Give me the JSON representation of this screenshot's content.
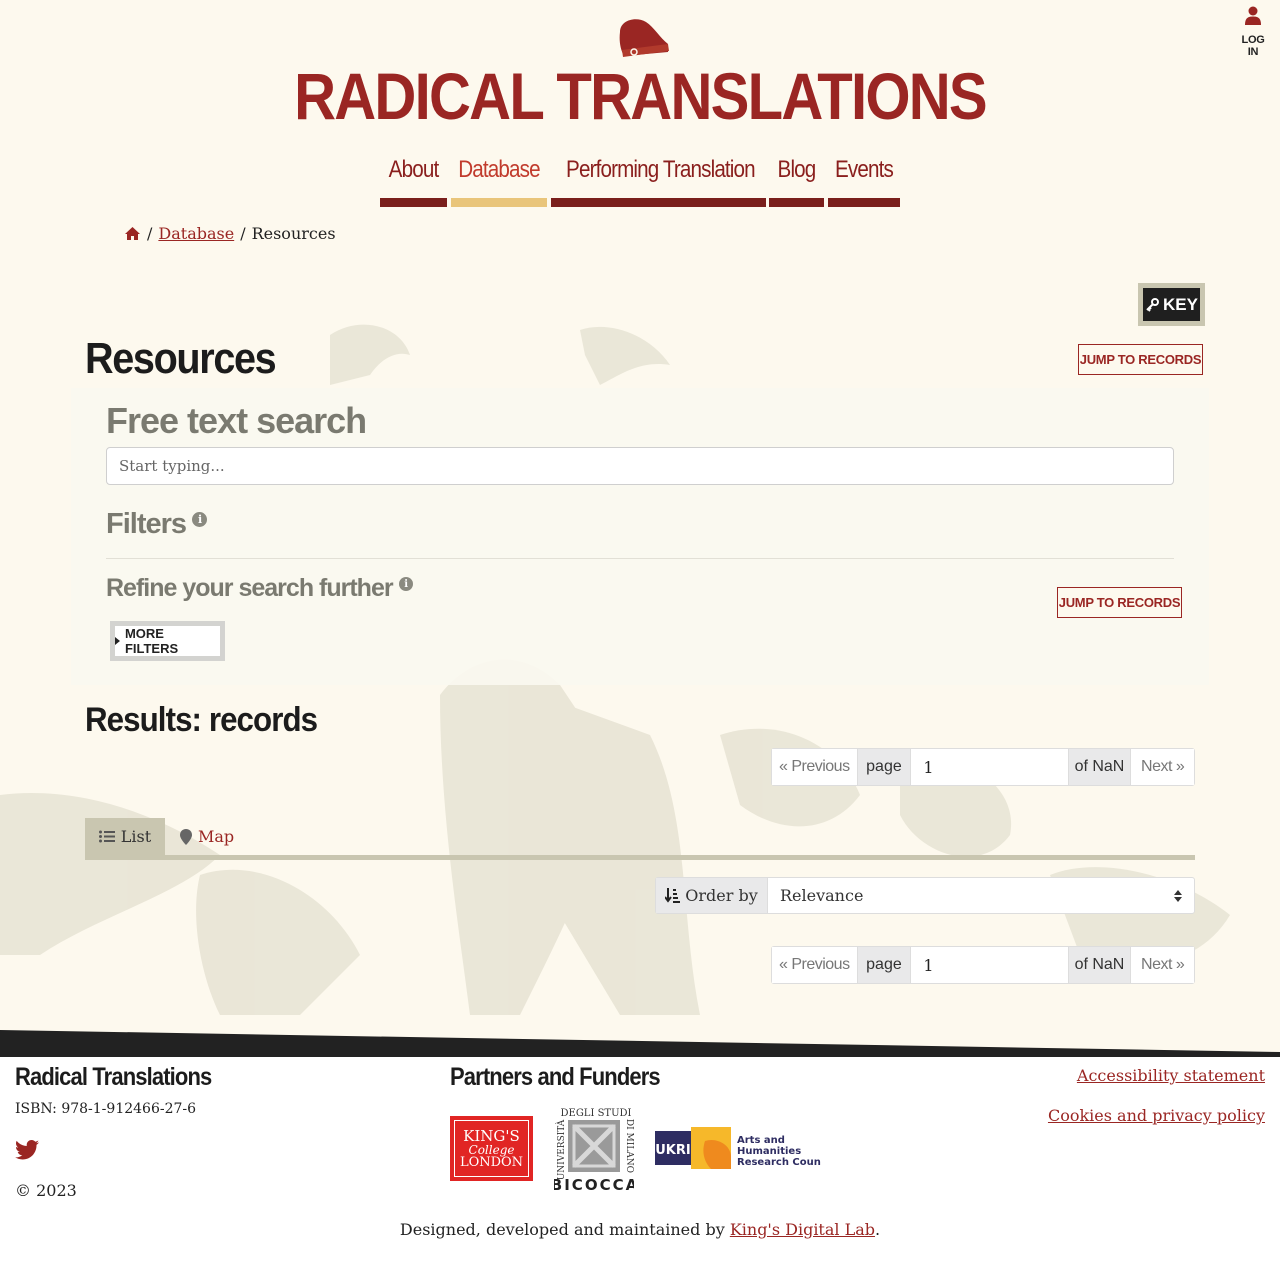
{
  "header": {
    "site_title": "RADICAL TRANSLATIONS",
    "login_label": "LOG IN"
  },
  "nav": {
    "items": [
      {
        "label": "About"
      },
      {
        "label": "Database"
      },
      {
        "label": "Performing Translation"
      },
      {
        "label": "Blog"
      },
      {
        "label": "Events"
      }
    ],
    "active": "Database"
  },
  "breadcrumb": {
    "link": "Database",
    "current": "Resources"
  },
  "key_button": "KEY",
  "page_title": "Resources",
  "jump_to_records": "JUMP TO RECORDS",
  "search": {
    "heading": "Free text search",
    "placeholder": "Start typing..."
  },
  "filters": {
    "heading": "Filters",
    "refine_heading": "Refine your search further",
    "more_filters": "MORE FILTERS"
  },
  "results": {
    "heading": "Results: records",
    "pager": {
      "previous": "« Previous",
      "page_label": "page",
      "page_value": "1",
      "of_label": "of NaN",
      "next": "Next »"
    },
    "tabs": {
      "list": "List",
      "map": "Map"
    },
    "order_by": {
      "label": "Order by",
      "value": "Relevance"
    }
  },
  "footer": {
    "site_name": "Radical Translations",
    "isbn": "ISBN: 978-1-912466-27-6",
    "copyright": "© 2023",
    "partners_heading": "Partners and Funders",
    "accessibility": "Accessibility statement",
    "cookies": "Cookies and privacy policy",
    "designed_prefix": "Designed, developed and maintained by ",
    "designed_link": "King's Digital Lab",
    "designed_suffix": "."
  },
  "logos": {
    "kcl": [
      "KING'S",
      "College",
      "LONDON"
    ],
    "bicocca_left": "UNIVERSITÀ",
    "bicocca_top": "DEGLI STUDI",
    "bicocca_right": "DI MILANO",
    "bicocca_bottom": "BICOCCA",
    "ukri": "UKRI",
    "ahrc": [
      "Arts and",
      "Humanities",
      "Research Council"
    ]
  },
  "colors": {
    "brand_red": "#9a2623",
    "nav_active_bar": "#e9c57a",
    "background": "#fdf9ee"
  },
  "icons": [
    "user-icon",
    "home-icon",
    "key-icon",
    "info-icon",
    "caret-right-icon",
    "list-icon",
    "map-marker-icon",
    "sort-icon",
    "select-arrows-icon",
    "twitter-icon"
  ]
}
